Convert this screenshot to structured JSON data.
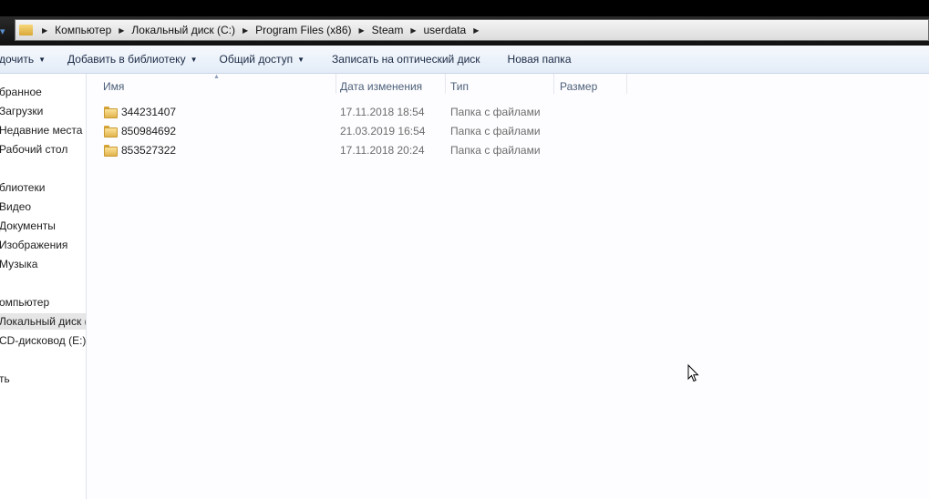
{
  "breadcrumb": [
    "Компьютер",
    "Локальный диск (C:)",
    "Program Files (x86)",
    "Steam",
    "userdata"
  ],
  "toolbar": {
    "organize": "дочить",
    "add_library": "Добавить в библиотеку",
    "share": "Общий доступ",
    "burn": "Записать на оптический диск",
    "new_folder": "Новая папка"
  },
  "sidebar": {
    "items": [
      "бранное",
      "Загрузки",
      "Недавние места",
      "Рабочий стол",
      "блиотеки",
      "Видео",
      "Документы",
      "Изображения",
      "Музыка",
      "омпьютер",
      "Локальный диск (",
      "CD-дисковод (E:)",
      "ть"
    ]
  },
  "columns": {
    "name": "Имя",
    "date": "Дата изменения",
    "type": "Тип",
    "size": "Размер"
  },
  "files": [
    {
      "name": "344231407",
      "date": "17.11.2018 18:54",
      "type": "Папка с файлами"
    },
    {
      "name": "850984692",
      "date": "21.03.2019 16:54",
      "type": "Папка с файлами"
    },
    {
      "name": "853527322",
      "date": "17.11.2018 20:24",
      "type": "Папка с файлами"
    }
  ],
  "icons": {
    "nav_arrow": "chevron-down-icon",
    "crumb_sep": "chevron-right-icon",
    "folder": "folder-icon",
    "cursor": "mouse-cursor-icon"
  }
}
